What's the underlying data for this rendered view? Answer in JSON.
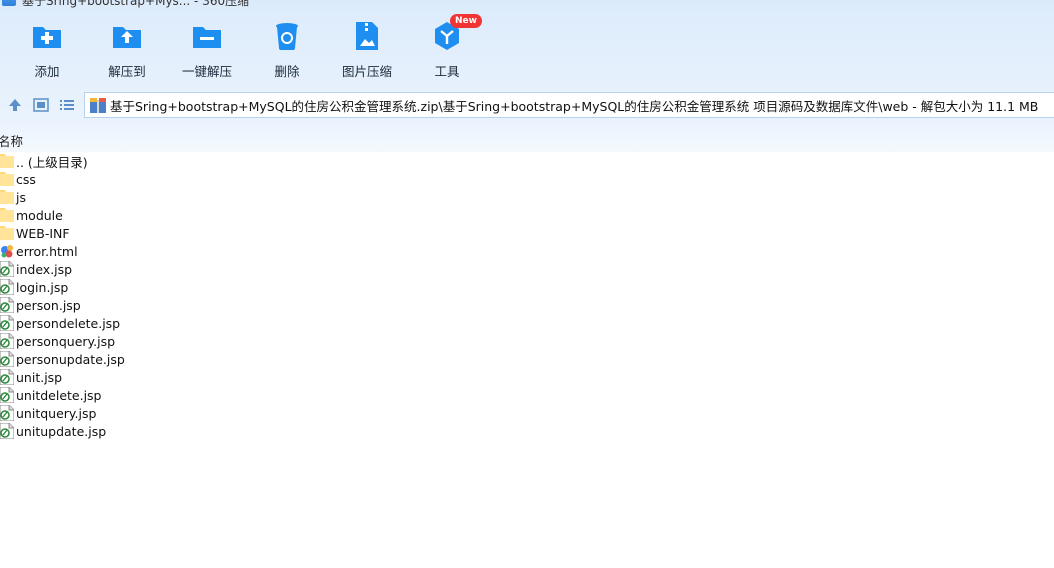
{
  "window": {
    "title": "基于Sring+bootstrap+Mys... - 360压缩"
  },
  "toolbar": [
    {
      "key": "add",
      "label": "添加",
      "icon": "add-icon"
    },
    {
      "key": "extract-to",
      "label": "解压到",
      "icon": "extract-to-icon"
    },
    {
      "key": "one-click-extract",
      "label": "一键解压",
      "icon": "one-click-extract-icon"
    },
    {
      "key": "delete",
      "label": "删除",
      "icon": "recycle-bin-icon"
    },
    {
      "key": "image-compress",
      "label": "图片压缩",
      "icon": "image-compress-icon"
    },
    {
      "key": "tools",
      "label": "工具",
      "icon": "tools-cube-icon"
    }
  ],
  "tools_badge": "New",
  "path": {
    "text": "基于Sring+bootstrap+MySQL的住房公积金管理系统.zip\\基于Sring+bootstrap+MySQL的住房公积金管理系统 项目源码及数据库文件\\web - 解包大小为 11.1 MB"
  },
  "columns": {
    "name": "名称"
  },
  "files": [
    {
      "name": ".. (上级目录)",
      "type": "folder"
    },
    {
      "name": "css",
      "type": "folder"
    },
    {
      "name": "js",
      "type": "folder"
    },
    {
      "name": "module",
      "type": "folder"
    },
    {
      "name": "WEB-INF",
      "type": "folder"
    },
    {
      "name": "error.html",
      "type": "html"
    },
    {
      "name": "index.jsp",
      "type": "jsp"
    },
    {
      "name": "login.jsp",
      "type": "jsp"
    },
    {
      "name": "person.jsp",
      "type": "jsp"
    },
    {
      "name": "persondelete.jsp",
      "type": "jsp"
    },
    {
      "name": "personquery.jsp",
      "type": "jsp"
    },
    {
      "name": "personupdate.jsp",
      "type": "jsp"
    },
    {
      "name": "unit.jsp",
      "type": "jsp"
    },
    {
      "name": "unitdelete.jsp",
      "type": "jsp"
    },
    {
      "name": "unitquery.jsp",
      "type": "jsp"
    },
    {
      "name": "unitupdate.jsp",
      "type": "jsp"
    }
  ],
  "colors": {
    "accent": "#1e8ff0",
    "badge": "#f03434",
    "folder": "#ffd978"
  }
}
